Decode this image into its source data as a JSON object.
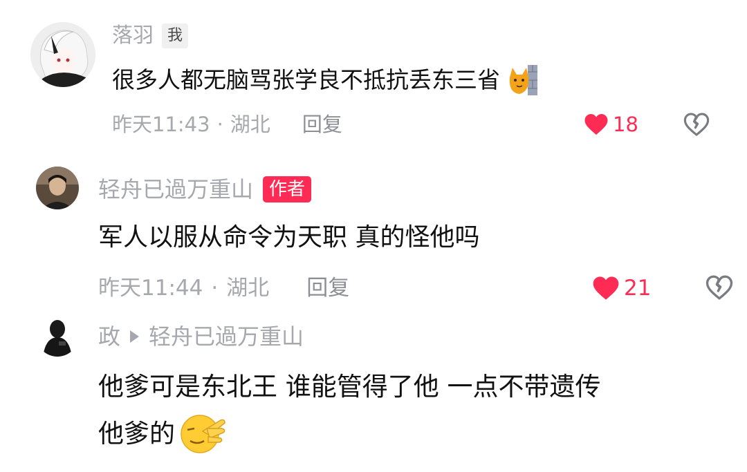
{
  "comments": [
    {
      "author": "落羽",
      "tag": "我",
      "text": "很多人都无脑骂张学良不抵抗丢东三省",
      "time": "昨天11:43",
      "location": "湖北",
      "reply": "回复",
      "likes": "18",
      "emoji": "cat-wall-emoji"
    },
    {
      "author": "轻舟已過万重山",
      "tag": "作者",
      "text": "军人以服从命令为天职 真的怪他吗",
      "time": "昨天11:44",
      "location": "湖北",
      "reply": "回复",
      "likes": "21"
    },
    {
      "author": "政",
      "reply_to": "轻舟已過万重山",
      "text_line1": "他爹可是东北王 谁能管得了他 一点不带遗传",
      "text_line2": "他爹的",
      "emoji": "facepalm-emoji"
    }
  ],
  "separator": "·",
  "colors": {
    "like_red": "#fe2c55",
    "author_tag_bg": "#fe2c55",
    "meta_gray": "#a7a8ad",
    "text_black": "#111111"
  }
}
